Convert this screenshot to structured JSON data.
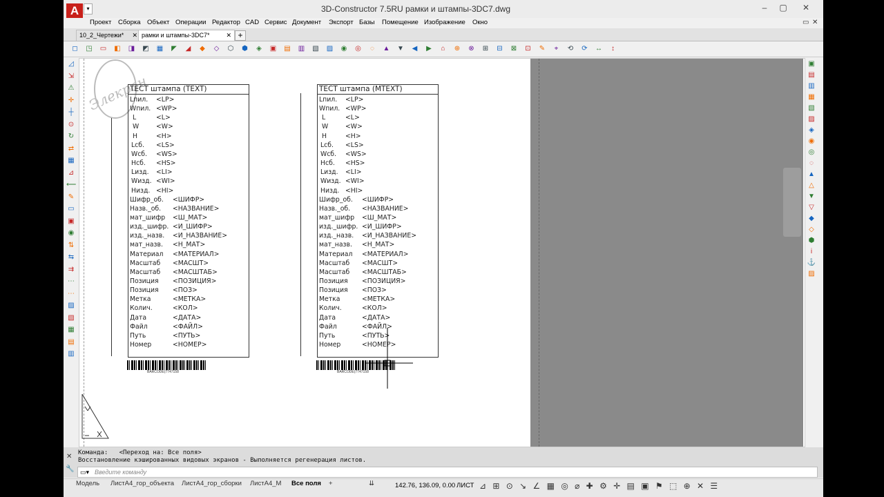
{
  "app": {
    "title": "3D-Constructor 7.5RU        рамки и штампы-3DC7.dwg",
    "logo": "A",
    "logo_dropdown": "▾",
    "window_min": "–",
    "window_max": "▢",
    "window_close": "✕",
    "restore": "▭",
    "close_doc": "✕"
  },
  "menu": [
    "Проект",
    "Сборка",
    "Объект",
    "Операции",
    "Редактор",
    "CAD",
    "Сервис",
    "Документ",
    "Экспорт",
    "Базы",
    "Помещение",
    "Изображение",
    "Окно"
  ],
  "tabs": [
    {
      "label": "10_2_Чертежи*",
      "close": "✕"
    },
    {
      "label": "рамки и штампы-3DC7*",
      "close": "✕"
    }
  ],
  "tab_add": "+",
  "toolbar": "◻◳▭◧◨◩▦◤◢◆◇⬡⬢◈▣▤▥▧▨◉◎◌▲▼◀▶⌂⊕⊗⊞⊟⊠⊡✎⌖⟲⟳↔↕",
  "left_tools": "◿⇲⚠✛┼⊙↻⇄▦⊿⟵✎▭▣◉⇅⇆⇉⋯⋯▨▧▦▤▥",
  "right_tools": "▣▤▥▦▧▨◈◉◎◌▲△▼▽◆◇⬢i⚓▨",
  "watermark": "Элекран",
  "stamps": [
    {
      "title": "ТЕСТ  штампа  (TEXT)",
      "barcode": "BARCODE(7747158",
      "rows": [
        [
          "Lпил.",
          "<LP>"
        ],
        [
          "Wпил.",
          "<WP>"
        ],
        [
          "L",
          "<L>"
        ],
        [
          "W",
          "<W>"
        ],
        [
          "H",
          "<H>"
        ],
        [
          "Lсб.",
          "<LS>"
        ],
        [
          "Wсб.",
          "<WS>"
        ],
        [
          "Hсб.",
          "<HS>"
        ],
        [
          "Lизд.",
          "<LI>"
        ],
        [
          "Wизд.",
          "<WI>"
        ],
        [
          "Hизд.",
          "<HI>"
        ],
        [
          "Шифр_об.",
          "<ШИФР>"
        ],
        [
          "Назв._об.",
          "<НАЗВАНИЕ>"
        ],
        [
          "мат_шифр",
          "<Ш_МАТ>"
        ],
        [
          "изд._шифр.",
          "<И_ШИФР>"
        ],
        [
          "изд._назв.",
          "<И_НАЗВАНИЕ>"
        ],
        [
          "мат_назв.",
          "<Н_МАТ>"
        ],
        [
          "Материал",
          "<МАТЕРИАЛ>"
        ],
        [
          "Масштаб",
          "<МАСШТ>"
        ],
        [
          "Масштаб",
          "<МАСШТАБ>"
        ],
        [
          "Позиция",
          "<ПОЗИЦИЯ>"
        ],
        [
          "Позиция",
          "<ПОЗ>"
        ],
        [
          "Метка",
          "<МЕТКА>"
        ],
        [
          "Колич.",
          "<КОЛ>"
        ],
        [
          "Дата",
          "<ДАТА>"
        ],
        [
          "Файл",
          "<ФАЙЛ>"
        ],
        [
          "Путь",
          "<ПУТЬ>"
        ],
        [
          "Номер",
          "<НОМЕР>"
        ]
      ]
    },
    {
      "title": "ТЕСТ  штампа  (MTEXT)",
      "barcode": "BARCODE(7747158",
      "rows": [
        [
          "Lпил.",
          "<LP>"
        ],
        [
          "Wпил.",
          "<WP>"
        ],
        [
          "L",
          "<L>"
        ],
        [
          "W",
          "<W>"
        ],
        [
          "H",
          "<H>"
        ],
        [
          "Lсб.",
          "<LS>"
        ],
        [
          "Wсб.",
          "<WS>"
        ],
        [
          "Hсб.",
          "<HS>"
        ],
        [
          "Lизд.",
          "<LI>"
        ],
        [
          "Wизд.",
          "<WI>"
        ],
        [
          "Hизд.",
          "<HI>"
        ],
        [
          "Шифр_об.",
          "<ШИФР>"
        ],
        [
          "Назв._об.",
          "<НАЗВАНИЕ>"
        ],
        [
          "мат_шифр",
          "<Ш_МАТ>"
        ],
        [
          "изд._шифр.",
          "<И_ШИФР>"
        ],
        [
          "изд._назв.",
          "<И_НАЗВАНИЕ>"
        ],
        [
          "мат_назв.",
          "<Н_МАТ>"
        ],
        [
          "Материал",
          "<МАТЕРИАЛ>"
        ],
        [
          "Масштаб",
          "<МАСШТ>"
        ],
        [
          "Масштаб",
          "<МАСШТАБ>"
        ],
        [
          "Позиция",
          "<ПОЗИЦИЯ>"
        ],
        [
          "Позиция",
          "<ПОЗ>"
        ],
        [
          "Метка",
          "<МЕТКА>"
        ],
        [
          "Колич.",
          "<КОЛ>"
        ],
        [
          "Дата",
          "<ДАТА>"
        ],
        [
          "Файл",
          "<ФАЙЛ>"
        ],
        [
          "Путь",
          "<ПУТЬ>"
        ],
        [
          "Номер",
          "<НОМЕР>"
        ]
      ]
    }
  ],
  "command": {
    "line1": "Команда:   <Переход на: Все поля>",
    "line2": "Восстановление кэшированных видовых экранов - Выполняется регенерация листов.",
    "placeholder": "Введите команду",
    "close": "✕",
    "wrench": "🔧",
    "prompt_icon": "▭▾"
  },
  "layouts": [
    "Модель",
    "ЛистА4_гор_объекта",
    "ЛистА4_гор_сборки",
    "ЛистА4_М",
    "Все поля"
  ],
  "layout_add": "+",
  "status": {
    "coords": "142.76, 136.09, 0.00",
    "mode": "ЛИСТ",
    "overflow": "⇊",
    "icons": "⊿ ⊞ ⊙ ↘ ∠ ▦ ◎ ⌀ ✚ ⚙ ✛ ▤ ▣ ⚑ ⬚ ⊕ ✕ ☰"
  }
}
